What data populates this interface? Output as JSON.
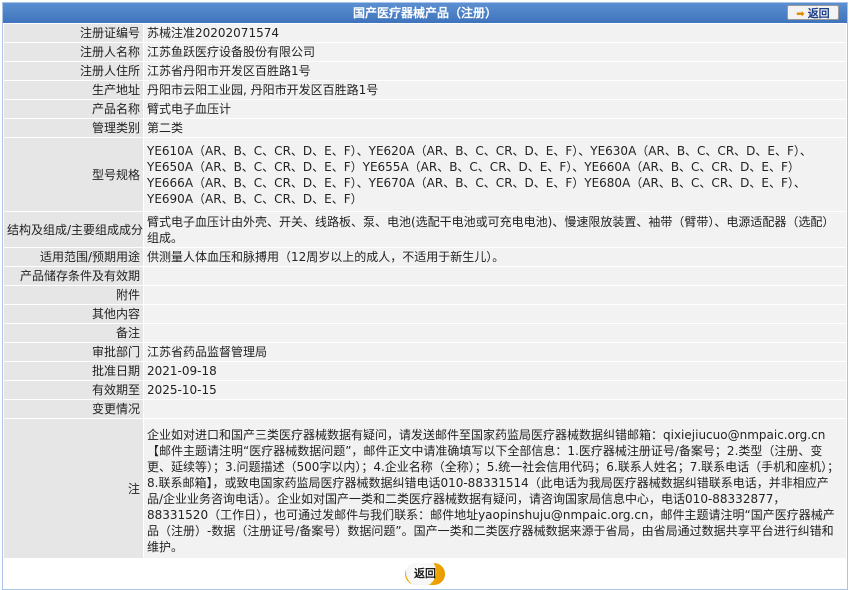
{
  "header": {
    "title": "国产医疗器械产品（注册）",
    "back_label": "返回"
  },
  "rows": {
    "reg_no": {
      "label": "注册证编号",
      "value": "苏械注准20202071574"
    },
    "registrant": {
      "label": "注册人名称",
      "value": "江苏鱼跃医疗设备股份有限公司"
    },
    "registrant_addr": {
      "label": "注册人住所",
      "value": "江苏省丹阳市开发区百胜路1号"
    },
    "production_addr": {
      "label": "生产地址",
      "value": "丹阳市云阳工业园, 丹阳市开发区百胜路1号"
    },
    "product_name": {
      "label": "产品名称",
      "value": "臂式电子血压计"
    },
    "mgmt_class": {
      "label": "管理类别",
      "value": "第二类"
    },
    "models": {
      "label": "型号规格",
      "value": "YE610A（AR、B、C、CR、D、E、F）、YE620A（AR、B、C、CR、D、E、F）、YE630A（AR、B、C、CR、D、E、F）、YE650A（AR、B、C、CR、D、E、F）YE655A（AR、B、C、CR、D、E、F）、YE660A（AR、B、C、CR、D、E、F）YE666A（AR、B、C、CR、D、E、F）、YE670A（AR、B、C、CR、D、E、F）YE680A（AR、B、C、CR、D、E、F）、YE690A（AR、B、C、CR、D、E、F）"
    },
    "structure": {
      "label": "结构及组成/主要组成成分",
      "value": "臂式电子血压计由外壳、开关、线路板、泵、电池(选配干电池或可充电电池)、慢速限放装置、袖带（臂带）、电源适配器（选配）组成。"
    },
    "scope": {
      "label": "适用范围/预期用途",
      "value": "供测量人体血压和脉搏用（12周岁以上的成人，不适用于新生儿）。"
    },
    "storage": {
      "label": "产品储存条件及有效期",
      "value": ""
    },
    "attachment": {
      "label": "附件",
      "value": ""
    },
    "other": {
      "label": "其他内容",
      "value": ""
    },
    "remarks": {
      "label": "备注",
      "value": ""
    },
    "approval_dept": {
      "label": "审批部门",
      "value": "江苏省药品监督管理局"
    },
    "approval_date": {
      "label": "批准日期",
      "value": "2021-09-18"
    },
    "valid_until": {
      "label": "有效期至",
      "value": "2025-10-15"
    },
    "changes": {
      "label": "变更情况",
      "value": ""
    },
    "note": {
      "label": "注",
      "value": "企业如对进口和国产三类医疗器械数据有疑问，请发送邮件至国家药监局医疗器械数据纠错邮箱：qixiejiucuo@nmpaic.org.cn【邮件主题请注明“医疗器械数据问题”，邮件正文中请准确填写以下全部信息：1.医疗器械注册证号/备案号；2.类型（注册、变更、延续等）；3.问题描述（500字以内）；4.企业名称（全称）；5.统一社会信用代码；6.联系人姓名；7.联系电话（手机和座机）；8.联系邮箱】，或致电国家药监局医疗器械数据纠错电话010-88331514（此电话为我局医疗器械数据纠错联系电话，并非相应产品/企业业务咨询电话）。企业如对国产一类和二类医疗器械数据有疑问，请咨询国家局信息中心，电话010-88332877，88331520（工作日），也可通过发邮件与我们联系：邮件地址yaopinshuju@nmpaic.org.cn，邮件主题请注明“国产医疗器械产品（注册）-数据（注册证号/备案号）数据问题”。国产一类和二类医疗器械数据来源于省局，由省局通过数据共享平台进行纠错和维护。"
    }
  },
  "footer": {
    "back_label": "返回"
  },
  "colors": {
    "title_bar": "#4a80c8",
    "label_bg": "#e6e6e6",
    "value_bg": "#f2f2f2",
    "back_accent": "#f0a800"
  },
  "icons": {
    "back": "back-arrow-icon"
  }
}
